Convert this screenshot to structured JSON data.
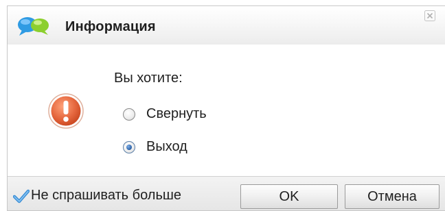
{
  "dialog": {
    "title": "Информация",
    "prompt": "Вы хотите:",
    "options": [
      {
        "label": "Свернуть",
        "selected": false
      },
      {
        "label": "Выход",
        "selected": true
      }
    ],
    "dont_ask_again": {
      "label": "Не спрашивать больше",
      "checked": true
    },
    "buttons": {
      "ok": "OK",
      "cancel": "Отмена"
    }
  },
  "icons": {
    "app": "chat-bubbles-icon",
    "warning": "exclamation-icon",
    "close": "close-icon",
    "check": "checkmark-icon"
  },
  "colors": {
    "warning_fill": "#e5673e",
    "accent_blue": "#2a5fa5",
    "bubble_blue": "#2f9be3",
    "bubble_green": "#8ccf2e"
  }
}
